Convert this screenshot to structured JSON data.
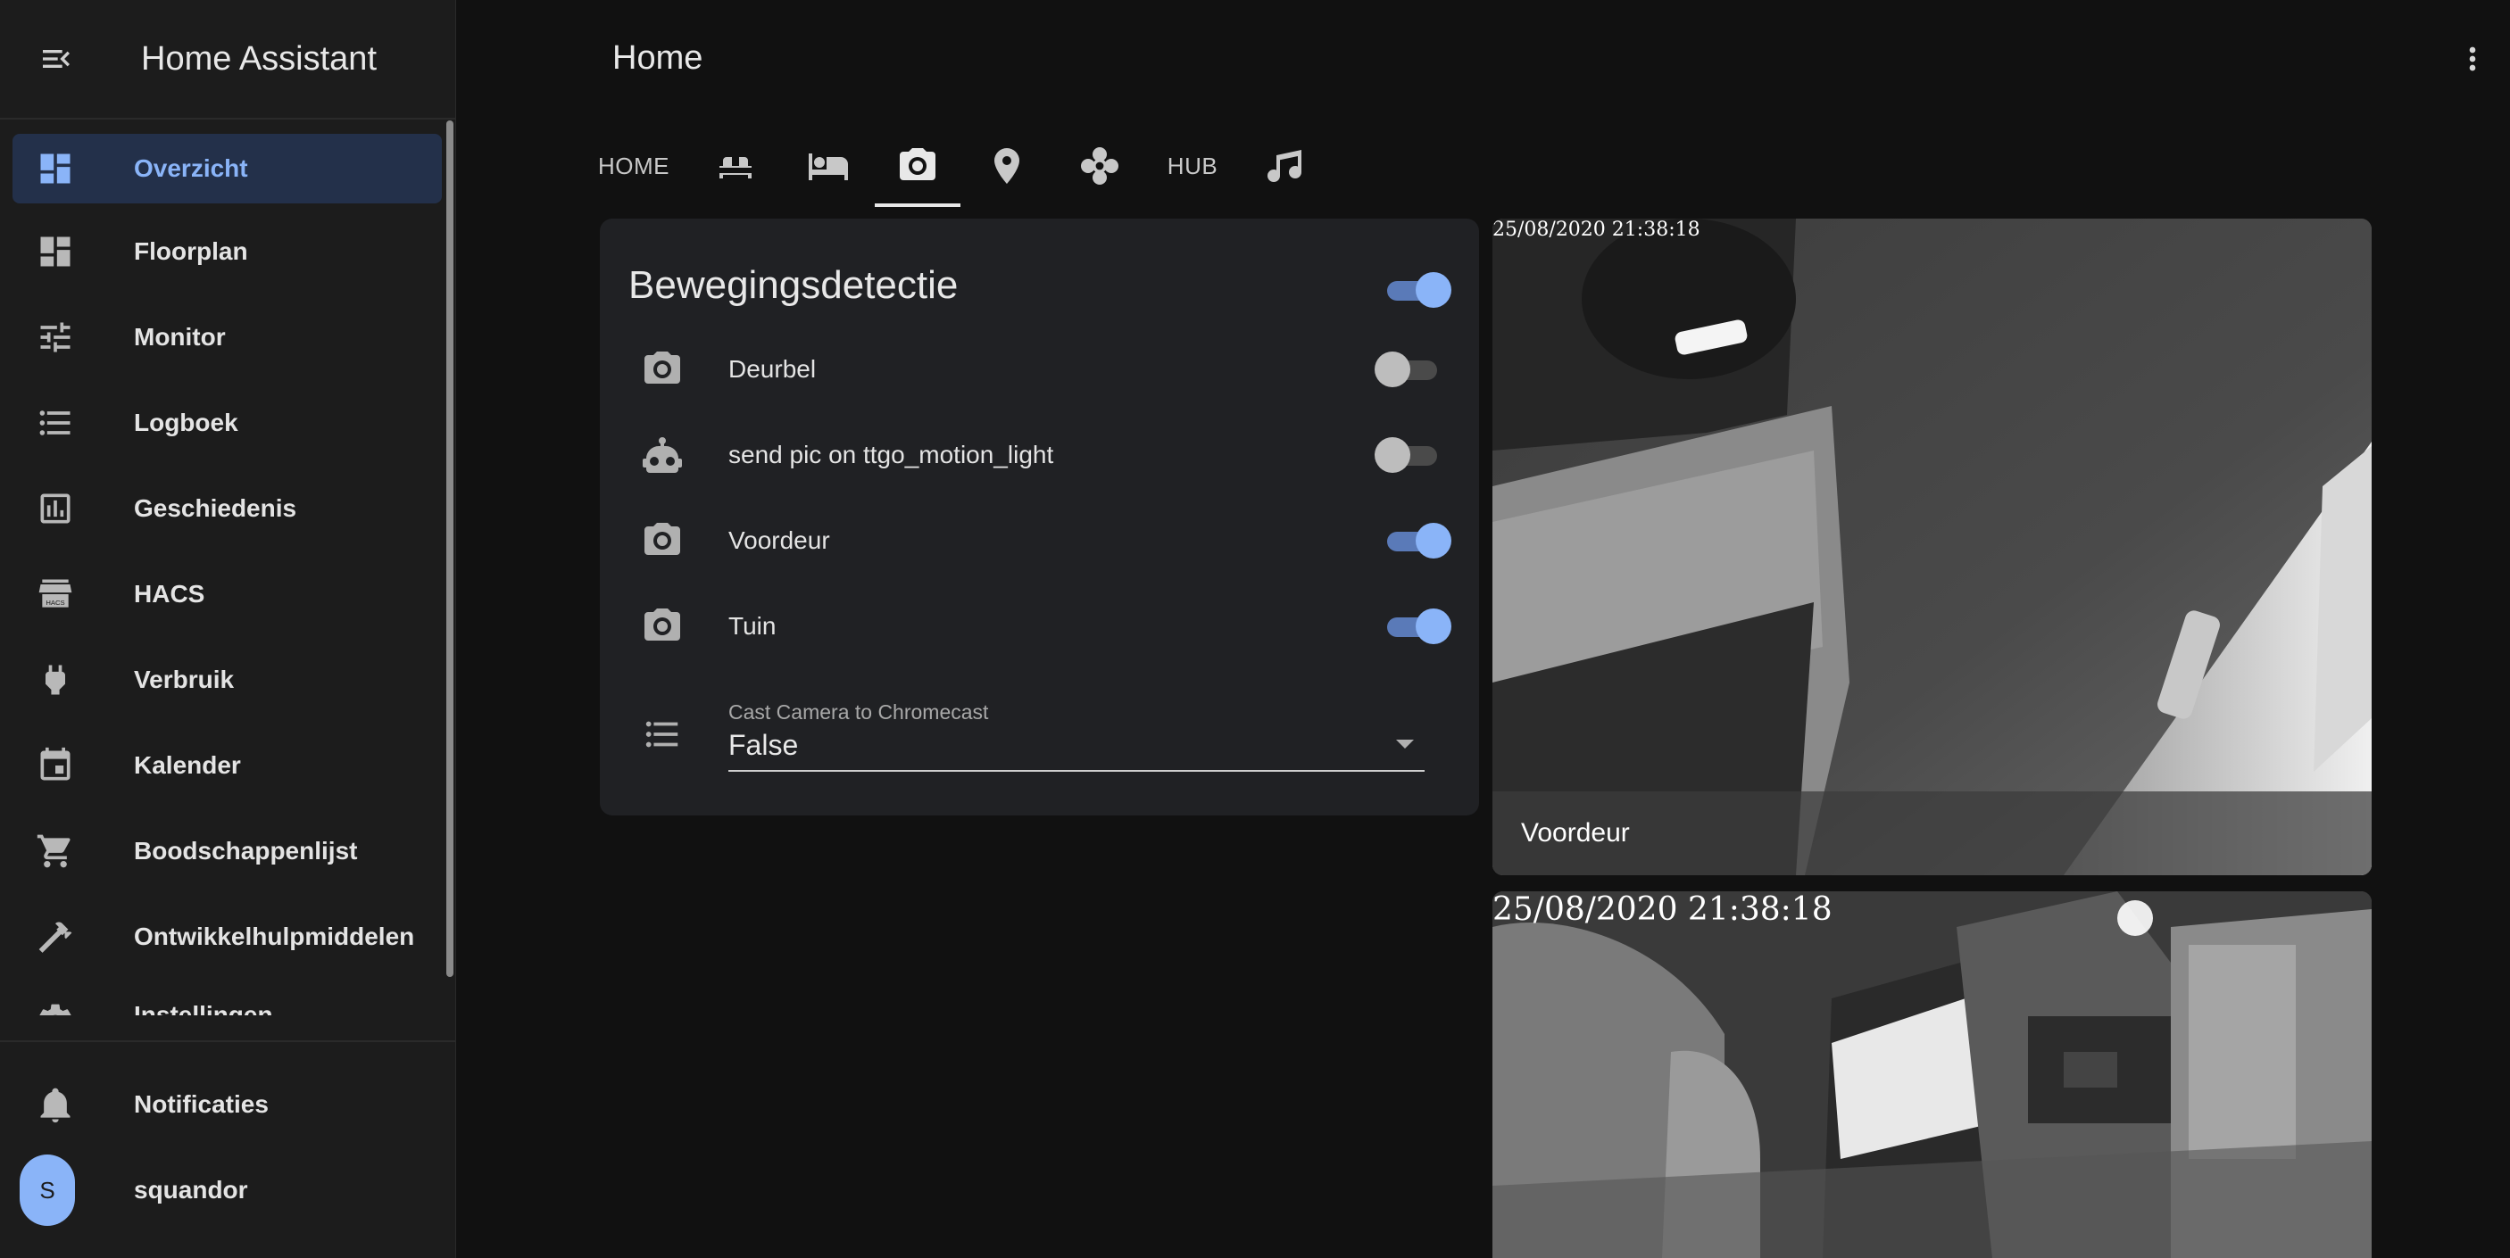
{
  "app": {
    "title": "Home Assistant",
    "page_title": "Home"
  },
  "sidebar": {
    "items": [
      {
        "label": "Overzicht",
        "icon": "dashboard-icon",
        "active": true
      },
      {
        "label": "Floorplan",
        "icon": "dashboard-icon",
        "active": false
      },
      {
        "label": "Monitor",
        "icon": "tune-icon",
        "active": false
      },
      {
        "label": "Logboek",
        "icon": "list-icon",
        "active": false
      },
      {
        "label": "Geschiedenis",
        "icon": "chart-box-icon",
        "active": false
      },
      {
        "label": "HACS",
        "icon": "hacs-store-icon",
        "active": false
      },
      {
        "label": "Verbruik",
        "icon": "plug-icon",
        "active": false
      },
      {
        "label": "Kalender",
        "icon": "calendar-icon",
        "active": false
      },
      {
        "label": "Boodschappenlijst",
        "icon": "cart-icon",
        "active": false
      },
      {
        "label": "Ontwikkelhulpmiddelen",
        "icon": "hammer-icon",
        "active": false
      },
      {
        "label": "Instellingen",
        "icon": "gear-icon",
        "active": false
      }
    ],
    "notifications_label": "Notificaties",
    "user": {
      "name": "squandor",
      "initial": "S"
    },
    "hacs_badge": "HACS"
  },
  "tabs": [
    {
      "type": "text",
      "label": "HOME"
    },
    {
      "type": "icon",
      "icon": "sofa-icon"
    },
    {
      "type": "icon",
      "icon": "bed-icon"
    },
    {
      "type": "icon",
      "icon": "camera-icon",
      "active": true
    },
    {
      "type": "icon",
      "icon": "map-marker-icon"
    },
    {
      "type": "icon",
      "icon": "fan-icon"
    },
    {
      "type": "text",
      "label": "HUB"
    },
    {
      "type": "icon",
      "icon": "music-note-icon"
    }
  ],
  "card": {
    "title": "Bewegingsdetectie",
    "master_on": true,
    "entities": [
      {
        "name": "Deurbel",
        "icon": "camera-icon",
        "on": false
      },
      {
        "name": "send pic on ttgo_motion_light",
        "icon": "robot-icon",
        "on": false
      },
      {
        "name": "Voordeur",
        "icon": "camera-icon",
        "on": true
      },
      {
        "name": "Tuin",
        "icon": "camera-icon",
        "on": true
      }
    ],
    "select": {
      "label": "Cast Camera to Chromecast",
      "value": "False",
      "icon": "format-list-icon"
    }
  },
  "cameras": [
    {
      "timestamp": "25/08/2020 21:38:18",
      "caption": "Voordeur"
    },
    {
      "timestamp": "25/08/2020 21:38:18"
    }
  ],
  "colors": {
    "accent": "#8ab4f8",
    "background": "#111111",
    "sidebar": "#1c1c1c",
    "card": "#202124"
  }
}
